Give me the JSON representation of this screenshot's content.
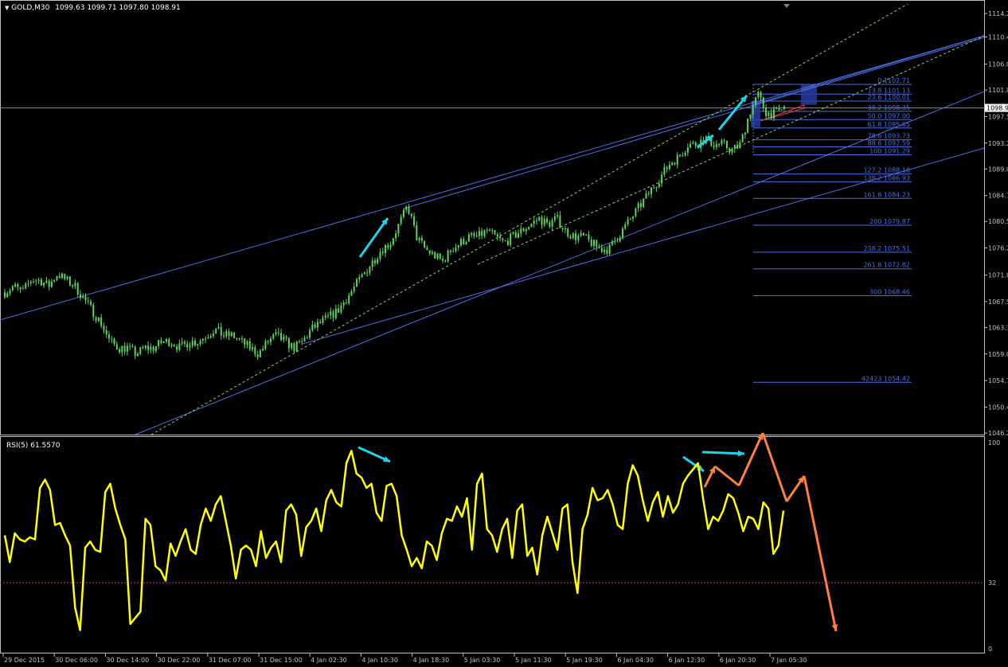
{
  "chart_data": [
    {
      "type": "candlestick",
      "title": "GOLD,M30",
      "ohlc": {
        "open": "1099.63",
        "high": "1099.71",
        "low": "1097.80",
        "close": "1098.91"
      },
      "price_axis_labels": [
        "1114.2",
        "1110.4",
        "1106.0",
        "1101.8",
        "1097.5",
        "1093.2",
        "1089.0",
        "1084.7",
        "1080.5",
        "1076.2",
        "1071.8",
        "1067.5",
        "1063.3",
        "1059.0",
        "1054.7",
        "1050.4",
        "1046.2"
      ],
      "current_price_label": "1098.9",
      "time_axis_labels": [
        "29 Dec 2015",
        "30 Dec 06:00",
        "30 Dec 14:00",
        "30 Dec 22:00",
        "31 Dec 07:00",
        "31 Dec 15:00",
        "4 Jan 02:30",
        "4 Jan 10:30",
        "4 Jan 18:30",
        "5 Jan 03:30",
        "5 Jan 11:30",
        "5 Jan 19:30",
        "6 Jan 04:30",
        "6 Jan 12:30",
        "6 Jan 20:30",
        "7 Jan 05:30"
      ],
      "price_path": [
        1069,
        1070,
        1069,
        1071,
        1071,
        1070,
        1072,
        1071,
        1070,
        1068,
        1066,
        1064,
        1061,
        1060,
        1060,
        1059,
        1060,
        1060,
        1061,
        1061,
        1060,
        1061,
        1061,
        1062,
        1063,
        1062,
        1062,
        1061,
        1060,
        1059,
        1061,
        1062,
        1061,
        1060,
        1061,
        1063,
        1064,
        1065,
        1066,
        1068,
        1070,
        1072,
        1074,
        1076,
        1077,
        1080,
        1083,
        1078,
        1076,
        1075,
        1074,
        1076,
        1077,
        1078,
        1078,
        1079,
        1078,
        1077,
        1078,
        1079,
        1080,
        1081,
        1080,
        1081,
        1079,
        1078,
        1078,
        1077,
        1076,
        1076,
        1078,
        1080,
        1082,
        1084,
        1086,
        1088,
        1090,
        1091,
        1093,
        1093,
        1094,
        1093,
        1093,
        1092,
        1093,
        1098,
        1101,
        1098,
        1098,
        1099
      ],
      "fibonacci_levels": [
        {
          "level": "0",
          "price": "1102.71"
        },
        {
          "level": "13.8",
          "price": "1101.13"
        },
        {
          "level": "23.6",
          "price": "1100.01"
        },
        {
          "level": "38.2",
          "price": "1098.35"
        },
        {
          "level": "50.0",
          "price": "1097.00"
        },
        {
          "level": "61.8",
          "price": "1095.65"
        },
        {
          "level": "78.6",
          "price": "1093.73"
        },
        {
          "level": "88.6",
          "price": "1092.59"
        },
        {
          "level": "100",
          "price": "1091.29"
        },
        {
          "level": "127.2",
          "price": "1088.18"
        },
        {
          "level": "138.2",
          "price": "1086.93"
        },
        {
          "level": "161.8",
          "price": "1084.23"
        },
        {
          "level": "200",
          "price": "1079.87"
        },
        {
          "level": "238.2",
          "price": "1075.51"
        },
        {
          "level": "261.8",
          "price": "1072.82"
        },
        {
          "level": "300",
          "price": "1068.46"
        },
        {
          "level": "42423",
          "price": "1054.42"
        }
      ],
      "colors": {
        "background": "#000000",
        "candles": "#5fd35f",
        "trendlines": "#4a6ee0",
        "fib": "#4a6ee0",
        "dotted": "#8fd36a",
        "axis_text": "#c0c0c0",
        "cyan_arrows": "#1fd3e6",
        "orange_arrows": "#ff7f3c",
        "rsi": "#ffff00"
      }
    },
    {
      "type": "line",
      "title": "RSI(5) 61.5570",
      "ylim": [
        0,
        100
      ],
      "axis_labels": [
        "100",
        "32",
        "0"
      ],
      "level_line": 32,
      "values": [
        55,
        42,
        56,
        53,
        52,
        54,
        53,
        78,
        82,
        77,
        60,
        61,
        55,
        50,
        20,
        9,
        49,
        52,
        48,
        47,
        76,
        80,
        68,
        60,
        53,
        12,
        15,
        18,
        63,
        60,
        40,
        38,
        33,
        51,
        45,
        52,
        58,
        48,
        46,
        60,
        68,
        62,
        70,
        74,
        62,
        50,
        34,
        48,
        50,
        48,
        40,
        57,
        44,
        49,
        52,
        42,
        67,
        70,
        65,
        45,
        59,
        62,
        68,
        57,
        72,
        77,
        71,
        69,
        90,
        96,
        85,
        83,
        78,
        80,
        66,
        62,
        79,
        80,
        74,
        55,
        48,
        40,
        44,
        39,
        52,
        50,
        43,
        56,
        63,
        62,
        69,
        64,
        73,
        48,
        80,
        85,
        58,
        55,
        47,
        58,
        63,
        44,
        67,
        70,
        45,
        49,
        36,
        55,
        64,
        56,
        48,
        68,
        70,
        42,
        27,
        58,
        65,
        78,
        72,
        73,
        77,
        70,
        60,
        58,
        80,
        89,
        84,
        72,
        62,
        71,
        76,
        64,
        74,
        66,
        70,
        80,
        84,
        87,
        90,
        73,
        58,
        64,
        62,
        67,
        75,
        73,
        66,
        57,
        64,
        63,
        58,
        71,
        68,
        46,
        50,
        67
      ],
      "colors": {
        "line": "#ffff00",
        "level": "#c03070"
      }
    }
  ]
}
